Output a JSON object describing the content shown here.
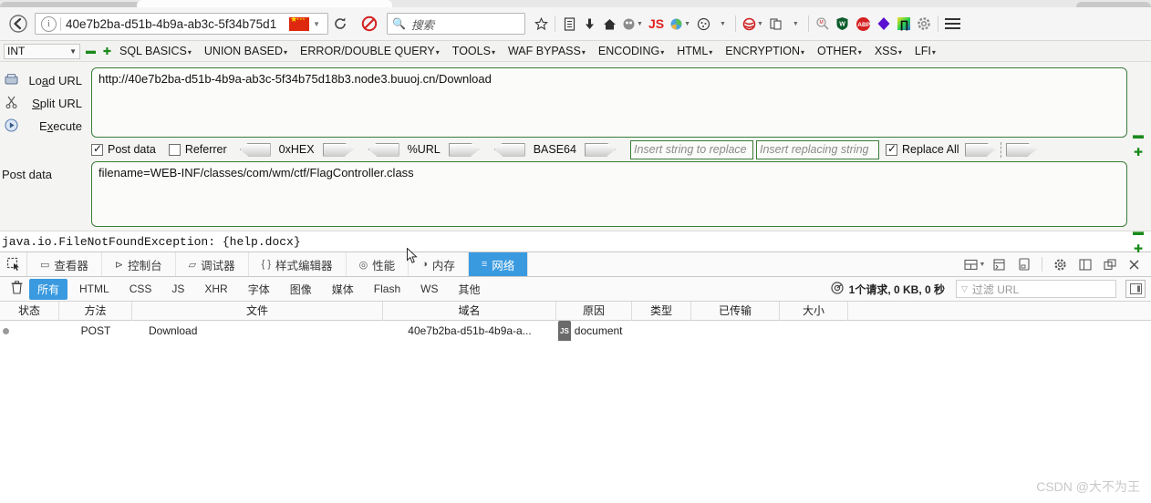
{
  "browser": {
    "back_icon": "back-arrow-icon",
    "info_icon": "site-info-icon",
    "url": "40e7b2ba-d51b-4b9a-ab3c-5f34b75d1",
    "flag": "cn-flag-icon",
    "reload_icon": "↻",
    "search_placeholder": "搜索",
    "toolbar_icons": [
      {
        "name": "bookmark-star-icon",
        "glyph": "☆"
      },
      {
        "name": "reader-list-icon",
        "glyph": "▤"
      },
      {
        "name": "downloads-icon",
        "glyph": "⬇"
      },
      {
        "name": "home-icon",
        "glyph": "⌂"
      },
      {
        "name": "ghostery-icon",
        "glyph": "◕"
      },
      {
        "name": "javascript-toggle-icon",
        "glyph": "JS"
      },
      {
        "name": "firebug-icon",
        "glyph": "◔"
      },
      {
        "name": "cookie-icon",
        "glyph": "◍"
      },
      {
        "name": "redirect-icon",
        "glyph": "⊜"
      },
      {
        "name": "useragent-switcher-icon",
        "glyph": "❐"
      },
      {
        "name": "zoom-search-icon",
        "glyph": "⌕"
      },
      {
        "name": "wappalyzer-icon",
        "glyph": "⬟"
      },
      {
        "name": "adblock-plus-icon",
        "glyph": "ABP"
      },
      {
        "name": "violet-diamond-icon",
        "glyph": "◆"
      },
      {
        "name": "proxy-switch-icon",
        "glyph": "∏"
      },
      {
        "name": "settings-gear-icon",
        "glyph": "⚙"
      },
      {
        "name": "menu-hamburger-icon",
        "glyph": "☰"
      }
    ]
  },
  "hackbar": {
    "type_select": "INT",
    "minus_label": "▬",
    "plus_label": "✚",
    "menus": [
      {
        "label": "SQL BASICS"
      },
      {
        "label": "UNION BASED"
      },
      {
        "label": "ERROR/DOUBLE QUERY"
      },
      {
        "label": "TOOLS"
      },
      {
        "label": "WAF BYPASS"
      },
      {
        "label": "ENCODING"
      },
      {
        "label": "HTML"
      },
      {
        "label": "ENCRYPTION"
      },
      {
        "label": "OTHER"
      },
      {
        "label": "XSS"
      },
      {
        "label": "LFI"
      }
    ],
    "actions": [
      {
        "label": "Load URL",
        "underline": "a",
        "icon": "load-url-icon"
      },
      {
        "label": "Split URL",
        "underline": "S",
        "icon": "split-url-icon"
      },
      {
        "label": "Execute",
        "underline": "x",
        "icon": "execute-icon"
      }
    ],
    "url_value": "http://40e7b2ba-d51b-4b9a-ab3c-5f34b75d18b3.node3.buuoj.cn/Download",
    "post_data_label": "Post data",
    "post_data_value": "filename=WEB-INF/classes/com/wm/ctf/FlagController.class",
    "options": {
      "post_data": {
        "label": "Post data",
        "checked": true
      },
      "referrer": {
        "label": "Referrer",
        "checked": false
      },
      "encoders": [
        {
          "label": "0xHEX"
        },
        {
          "label": "%URL"
        },
        {
          "label": "BASE64"
        }
      ],
      "search_placeholder": "Insert string to replace",
      "replace_placeholder": "Insert replacing string",
      "replace_all": {
        "label": "Replace All",
        "checked": true
      }
    }
  },
  "exception": {
    "text": "java.io.FileNotFoundException: {help.docx}"
  },
  "devtools": {
    "picker_icon": "element-picker-icon",
    "tabs": [
      {
        "label": "查看器",
        "icon": "inspector-icon",
        "active": false
      },
      {
        "label": "控制台",
        "icon": "console-icon",
        "active": false
      },
      {
        "label": "调试器",
        "icon": "debugger-icon",
        "active": false
      },
      {
        "label": "样式编辑器",
        "icon": "style-editor-icon",
        "active": false
      },
      {
        "label": "性能",
        "icon": "performance-icon",
        "active": false
      },
      {
        "label": "内存",
        "icon": "memory-icon",
        "active": false
      },
      {
        "label": "网络",
        "icon": "network-icon",
        "active": true
      }
    ],
    "right_icons": [
      {
        "name": "responsive-layout-icon",
        "glyph": "▤"
      },
      {
        "name": "split-console-icon",
        "glyph": "▥"
      },
      {
        "name": "device-mode-icon",
        "glyph": "▯"
      },
      {
        "name": "devtools-settings-icon",
        "glyph": "⚙"
      },
      {
        "name": "dock-side-icon",
        "glyph": "▣"
      },
      {
        "name": "dock-window-icon",
        "glyph": "⧉"
      },
      {
        "name": "close-devtools-icon",
        "glyph": "✕"
      }
    ],
    "filters": {
      "trash_icon": "clear-requests-icon",
      "buttons": [
        {
          "label": "所有",
          "active": true
        },
        {
          "label": "HTML",
          "active": false
        },
        {
          "label": "CSS",
          "active": false
        },
        {
          "label": "JS",
          "active": false
        },
        {
          "label": "XHR",
          "active": false
        },
        {
          "label": "字体",
          "active": false
        },
        {
          "label": "图像",
          "active": false
        },
        {
          "label": "媒体",
          "active": false
        },
        {
          "label": "Flash",
          "active": false
        },
        {
          "label": "WS",
          "active": false
        },
        {
          "label": "其他",
          "active": false
        }
      ],
      "summary": "1个请求, 0 KB, 0 秒",
      "summary_icon": "throttle-icon",
      "url_filter_placeholder": "过滤 URL",
      "url_filter_icon": "funnel-icon",
      "panel_toggle_icon": "toggle-sidebar-icon"
    },
    "network_table": {
      "columns": [
        "状态",
        "方法",
        "文件",
        "域名",
        "原因",
        "类型",
        "已传输",
        "大小"
      ],
      "rows": [
        {
          "status": "",
          "status_dot": true,
          "method": "POST",
          "file": "Download",
          "domain": "40e7b2ba-d51b-4b9a-a...",
          "cause_badge": "JS",
          "cause": "document",
          "type": "",
          "transferred": "",
          "size": ""
        }
      ]
    }
  },
  "watermark": {
    "text": "CSDN @大不为王"
  }
}
